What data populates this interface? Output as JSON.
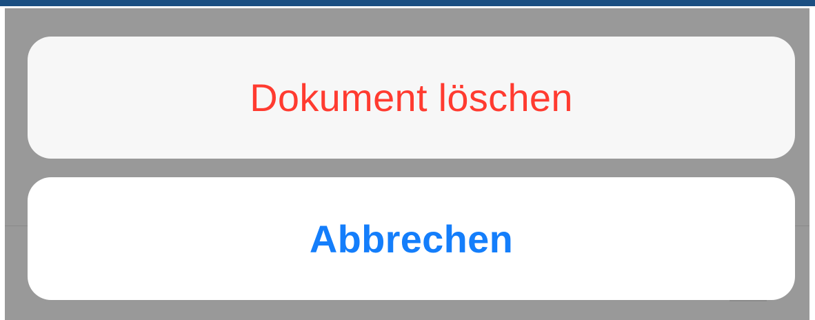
{
  "action_sheet": {
    "destructive_label": "Dokument löschen",
    "cancel_label": "Abbrechen"
  },
  "colors": {
    "destructive": "#ff3b30",
    "cancel": "#147efb",
    "overlay": "#999999",
    "header_bar": "#1b4f82"
  }
}
